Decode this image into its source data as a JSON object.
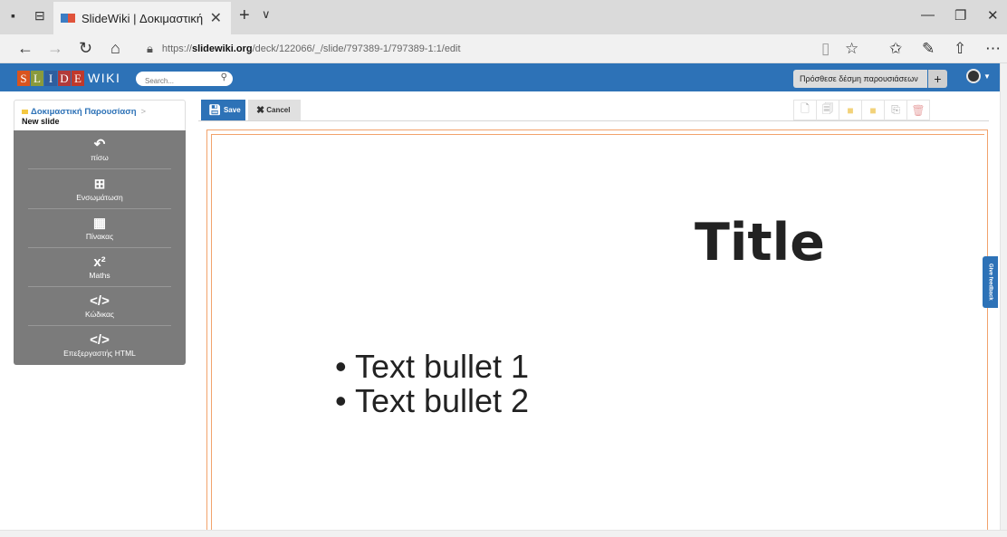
{
  "browser": {
    "tab_title": "SlideWiki | Δοκιμαστική",
    "tab_close": "✕",
    "new_tab": "+",
    "tab_dropdown": "∨",
    "url_prefix": "https://",
    "url_domain": "slidewiki.org",
    "url_path": "/deck/122066/_/slide/797389-1/797389-1:1/edit",
    "window_controls": {
      "minimize": "—",
      "maximize": "❐",
      "close": "✕"
    }
  },
  "app": {
    "logo_letters": [
      "S",
      "L",
      "I",
      "D",
      "E"
    ],
    "logo_colors": [
      "#d9541e",
      "#8a9a3c",
      "#2f5e9e",
      "#b23a3a",
      "#c0392b"
    ],
    "logo_wiki": "WIKI",
    "search_placeholder": "Search...",
    "add_source_label": "Πρόσθεσε δέσμη παρουσιάσεων",
    "add_source_icon": "+",
    "accent": "#2d72b7"
  },
  "breadcrumb": {
    "deck": "Δοκιμαστική Παρουσίαση",
    "separator": ">",
    "slide": "New slide"
  },
  "sidebar": {
    "items": [
      {
        "icon": "undo-icon",
        "glyph": "↶",
        "label": "πίσω"
      },
      {
        "icon": "plus-square-icon",
        "glyph": "⊞",
        "label": "Ενσωμάτωση"
      },
      {
        "icon": "table-icon",
        "glyph": "▦",
        "label": "Πίνακας"
      },
      {
        "icon": "superscript-icon",
        "glyph": "x²",
        "label": "Maths"
      },
      {
        "icon": "code-icon",
        "glyph": "</>",
        "label": "Κώδικας"
      },
      {
        "icon": "code-icon",
        "glyph": "</>",
        "label": "Επεξεργαστής HTML"
      }
    ]
  },
  "editor": {
    "save_label": "Save",
    "cancel_label": "Cancel",
    "right_tools": [
      "file-add-icon",
      "file-duplicate-icon",
      "folder-add-icon",
      "folder-icon",
      "copy-icon",
      "trash-icon"
    ]
  },
  "slide": {
    "title": "Title",
    "bullets": [
      "• Text bullet 1",
      "• Text bullet 2"
    ]
  },
  "feedback_label": "Give feedback"
}
